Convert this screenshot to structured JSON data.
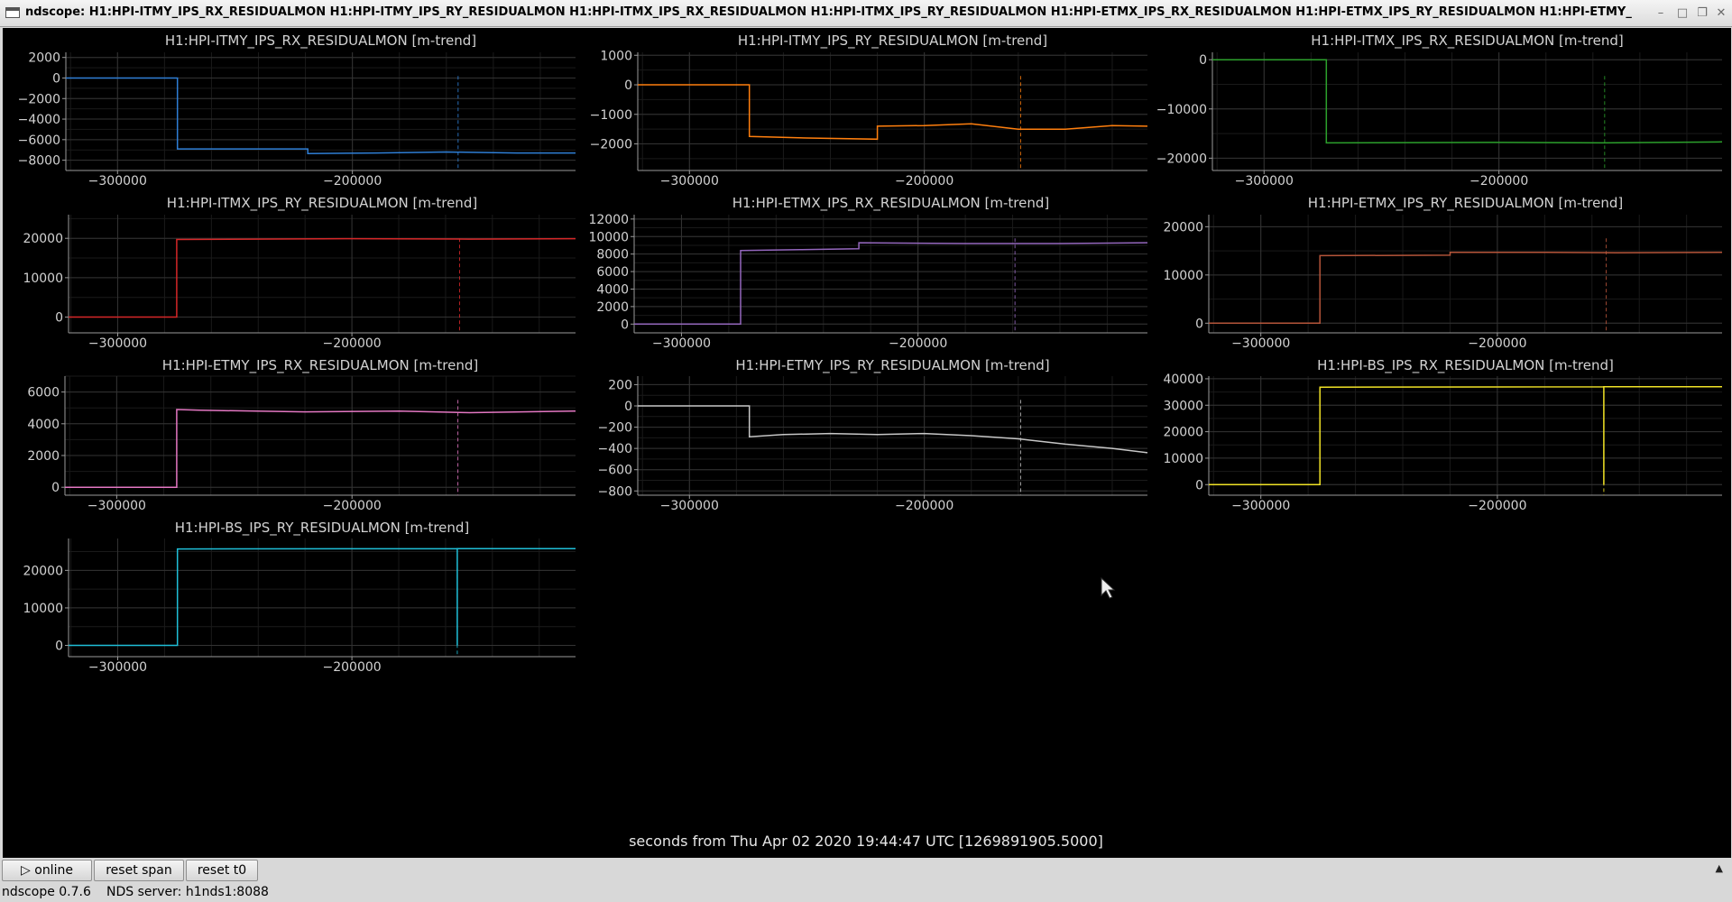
{
  "window": {
    "title": "ndscope: H1:HPI-ITMY_IPS_RX_RESIDUALMON H1:HPI-ITMY_IPS_RY_RESIDUALMON H1:HPI-ITMX_IPS_RX_RESIDUALMON H1:HPI-ITMX_IPS_RY_RESIDUALMON H1:HPI-ETMX_IPS_RX_RESIDUALMON H1:HPI-ETMX_IPS_RY_RESIDUALMON H1:HPI-ETMY_",
    "controls": {
      "minimize": "–",
      "maximize": "□",
      "restore": "❐",
      "close": "✕"
    },
    "icons": {
      "app": "window-icon",
      "minimize": "minimize-icon",
      "maximize": "maximize-icon",
      "close": "close-icon"
    }
  },
  "chart_data": [
    {
      "type": "line",
      "title": "H1:HPI-ITMY_IPS_RX_RESIDUALMON [m-trend]",
      "color": "#2f7fd6",
      "xlim": [
        -322000,
        -105000
      ],
      "ylim": [
        -9000,
        2500
      ],
      "yticks": [
        2000,
        0,
        -2000,
        -4000,
        -6000,
        -8000
      ],
      "xticks": [
        -300000,
        -200000
      ],
      "marker_x": -155000,
      "grid": true,
      "x": [
        -322000,
        -274500,
        -274500,
        -219000,
        -219000,
        -190000,
        -160000,
        -130000,
        -105000
      ],
      "y": [
        0,
        0,
        -6900,
        -6900,
        -7350,
        -7300,
        -7200,
        -7300,
        -7300
      ]
    },
    {
      "type": "line",
      "title": "H1:HPI-ITMY_IPS_RY_RESIDUALMON [m-trend]",
      "color": "#ff7f0e",
      "xlim": [
        -322000,
        -105000
      ],
      "ylim": [
        -2900,
        1100
      ],
      "yticks": [
        1000,
        0,
        -1000,
        -2000
      ],
      "xticks": [
        -300000,
        -200000
      ],
      "marker_x": -159000,
      "grid": true,
      "x": [
        -322000,
        -274500,
        -274500,
        -250000,
        -220000,
        -220000,
        -200000,
        -180000,
        -160000,
        -140000,
        -120000,
        -105000
      ],
      "y": [
        0,
        0,
        -1750,
        -1800,
        -1840,
        -1400,
        -1380,
        -1320,
        -1500,
        -1500,
        -1380,
        -1400
      ]
    },
    {
      "type": "line",
      "title": "H1:HPI-ITMX_IPS_RX_RESIDUALMON [m-trend]",
      "color": "#2ca02c",
      "xlim": [
        -322000,
        -105000
      ],
      "ylim": [
        -22500,
        1500
      ],
      "yticks": [
        0,
        -10000,
        -20000
      ],
      "xticks": [
        -300000,
        -200000
      ],
      "marker_x": -155000,
      "grid": true,
      "x": [
        -322000,
        -273500,
        -273500,
        -200000,
        -155000,
        -105000
      ],
      "y": [
        0,
        0,
        -16900,
        -16800,
        -16900,
        -16700
      ]
    },
    {
      "type": "line",
      "title": "H1:HPI-ITMX_IPS_RY_RESIDUALMON [m-trend]",
      "color": "#d62728",
      "xlim": [
        -321000,
        -104500
      ],
      "ylim": [
        -4000,
        26000
      ],
      "yticks": [
        20000,
        10000,
        0
      ],
      "xticks": [
        -300000,
        -200000
      ],
      "marker_x": -154000,
      "grid": true,
      "x": [
        -321000,
        -274800,
        -274800,
        -200000,
        -150000,
        -104500
      ],
      "y": [
        0,
        0,
        19700,
        19900,
        19800,
        19900
      ]
    },
    {
      "type": "line",
      "title": "H1:HPI-ETMX_IPS_RX_RESIDUALMON [m-trend]",
      "color": "#9467bd",
      "xlim": [
        -320000,
        -103000
      ],
      "ylim": [
        -1000,
        12500
      ],
      "yticks": [
        12000,
        10000,
        8000,
        6000,
        4000,
        2000,
        0
      ],
      "xticks": [
        -300000,
        -200000
      ],
      "marker_x": -159000,
      "grid": true,
      "x": [
        -320000,
        -275000,
        -275000,
        -250000,
        -225000,
        -225000,
        -180000,
        -140000,
        -103000
      ],
      "y": [
        0,
        0,
        8400,
        8500,
        8600,
        9300,
        9200,
        9200,
        9300
      ]
    },
    {
      "type": "line",
      "title": "H1:HPI-ETMX_IPS_RY_RESIDUALMON [m-trend]",
      "color": "#b5553a",
      "xlim": [
        -322000,
        -105000
      ],
      "ylim": [
        -2000,
        22500
      ],
      "yticks": [
        20000,
        10000,
        0
      ],
      "xticks": [
        -300000,
        -200000
      ],
      "marker_x": -154000,
      "grid": true,
      "x": [
        -322000,
        -275000,
        -275000,
        -220000,
        -220000,
        -180000,
        -150000,
        -105000
      ],
      "y": [
        0,
        0,
        14000,
        14100,
        14700,
        14700,
        14600,
        14700
      ]
    },
    {
      "type": "line",
      "title": "H1:HPI-ETMY_IPS_RX_RESIDUALMON [m-trend]",
      "color": "#e377c2",
      "xlim": [
        -322000,
        -105000
      ],
      "ylim": [
        -500,
        7000
      ],
      "yticks": [
        6000,
        4000,
        2000,
        0
      ],
      "xticks": [
        -300000,
        -200000
      ],
      "marker_x": -155000,
      "grid": true,
      "x": [
        -322000,
        -274500,
        -274500,
        -265000,
        -220000,
        -180000,
        -150000,
        -105000
      ],
      "y": [
        0,
        0,
        4900,
        4850,
        4750,
        4800,
        4700,
        4800
      ]
    },
    {
      "type": "line",
      "title": "H1:HPI-ETMY_IPS_RY_RESIDUALMON [m-trend]",
      "color": "#c7c7c7",
      "xlim": [
        -322000,
        -105000
      ],
      "ylim": [
        -840,
        280
      ],
      "yticks": [
        200,
        0,
        -200,
        -400,
        -600,
        -800
      ],
      "xticks": [
        -300000,
        -200000
      ],
      "marker_x": -159000,
      "grid": true,
      "x": [
        -322000,
        -274500,
        -274500,
        -260000,
        -240000,
        -220000,
        -200000,
        -180000,
        -160000,
        -140000,
        -120000,
        -105000
      ],
      "y": [
        0,
        0,
        -290,
        -270,
        -260,
        -270,
        -260,
        -280,
        -310,
        -360,
        -400,
        -440
      ]
    },
    {
      "type": "line",
      "title": "H1:HPI-BS_IPS_RX_RESIDUALMON [m-trend]",
      "color": "#f0e226",
      "xlim": [
        -322000,
        -105000
      ],
      "ylim": [
        -4000,
        41000
      ],
      "yticks": [
        40000,
        30000,
        20000,
        10000,
        0
      ],
      "xticks": [
        -300000,
        -200000
      ],
      "marker_x": -155000,
      "grid": true,
      "x": [
        -322000,
        -275000,
        -275000,
        -155000,
        -155000,
        -155000,
        -105000
      ],
      "y": [
        0,
        0,
        36800,
        37000,
        0,
        37000,
        37000
      ]
    },
    {
      "type": "line",
      "title": "H1:HPI-BS_IPS_RY_RESIDUALMON [m-trend]",
      "color": "#1fbfd8",
      "xlim": [
        -321000,
        -104500
      ],
      "ylim": [
        -3000,
        28500
      ],
      "yticks": [
        20000,
        10000,
        0
      ],
      "xticks": [
        -300000,
        -200000
      ],
      "marker_x": -155000,
      "grid": true,
      "x": [
        -321000,
        -274500,
        -274500,
        -155000,
        -155000,
        -155000,
        -104500
      ],
      "y": [
        0,
        0,
        25700,
        25800,
        0,
        25800,
        25800
      ]
    }
  ],
  "axis": {
    "xlabel": "seconds from Thu Apr 02 2020 19:44:47 UTC [1269891905.5000]"
  },
  "toolbar": {
    "online_label": "▷ online",
    "reset_span_label": "reset span",
    "reset_t0_label": "reset t0",
    "collapse_glyph": "▲"
  },
  "status": {
    "version": "ndscope 0.7.6",
    "server": "NDS server: h1nds1:8088"
  }
}
